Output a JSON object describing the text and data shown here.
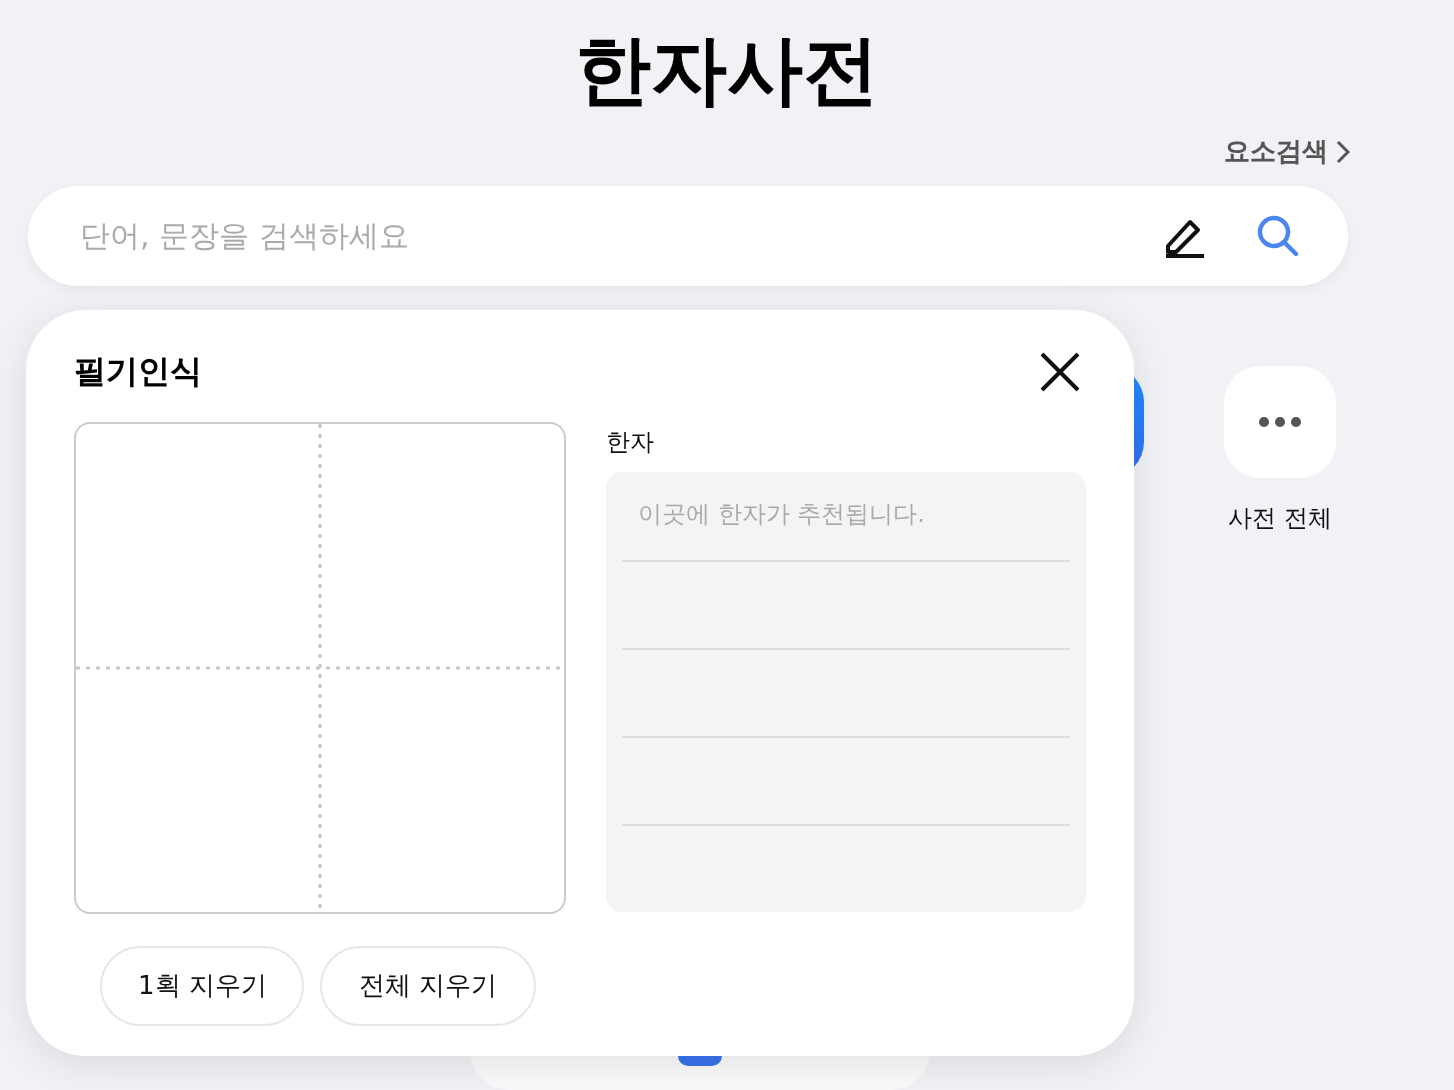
{
  "header": {
    "title": "한자사전",
    "element_search_link": "요소검색"
  },
  "search": {
    "placeholder": "단어, 문장을 검색하세요"
  },
  "shortcuts": [
    {
      "kind": "blue"
    },
    {
      "kind": "more",
      "label": "사전 전체"
    }
  ],
  "handwriting_panel": {
    "title": "필기인식",
    "candidates_label": "한자",
    "candidates_placeholder": "이곳에 한자가 추천됩니다.",
    "buttons": [
      "1획 지우기",
      "전체 지우기"
    ]
  }
}
